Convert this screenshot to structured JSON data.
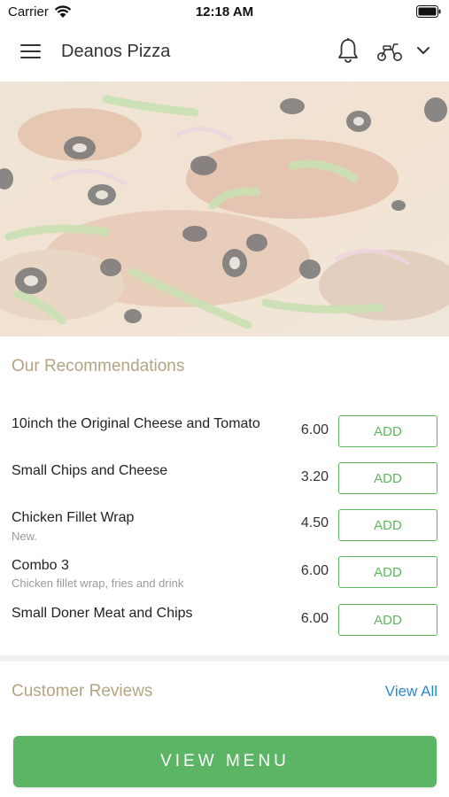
{
  "status_bar": {
    "carrier": "Carrier",
    "time": "12:18 AM"
  },
  "header": {
    "title": "Deanos Pizza",
    "icons": [
      "menu-icon",
      "bell-icon",
      "scooter-icon",
      "chevron-down-icon"
    ]
  },
  "recommendations": {
    "title": "Our Recommendations",
    "add_label": "ADD",
    "items": [
      {
        "name": "10inch the Original Cheese and Tomato",
        "description": "",
        "price": "6.00"
      },
      {
        "name": "Small Chips and Cheese",
        "description": "",
        "price": "3.20"
      },
      {
        "name": "Chicken Fillet Wrap",
        "description": "New.",
        "price": "4.50"
      },
      {
        "name": "Combo 3",
        "description": "Chicken fillet wrap, fries and drink",
        "price": "6.00"
      },
      {
        "name": "Small Doner Meat and Chips",
        "description": "",
        "price": "6.00"
      }
    ]
  },
  "reviews": {
    "title": "Customer Reviews",
    "view_all_label": "View All"
  },
  "footer": {
    "view_menu_label": "VIEW MENU"
  },
  "colors": {
    "accent_green": "#5cb85c",
    "section_title": "#b4a582",
    "link_blue": "#2a8ad4"
  }
}
